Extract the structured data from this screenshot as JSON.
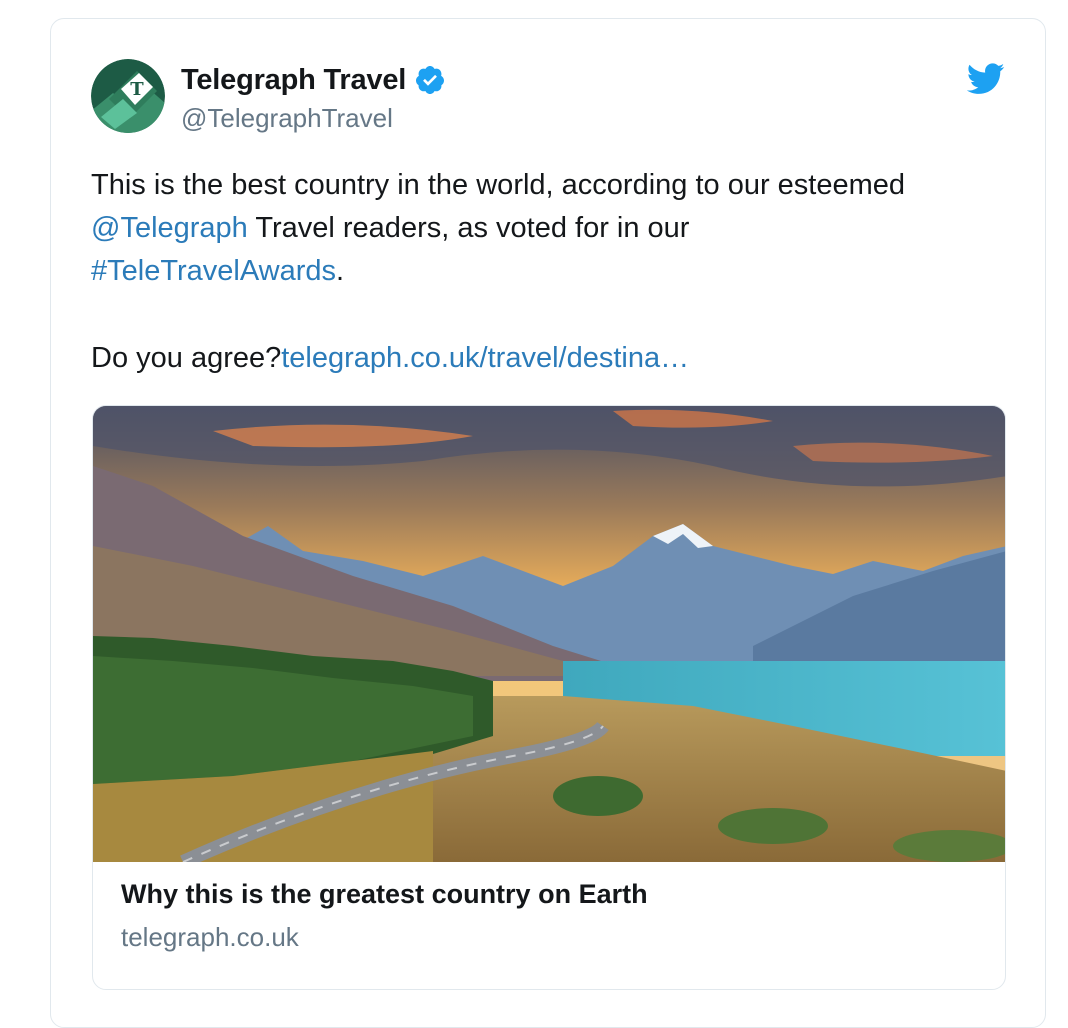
{
  "author": {
    "display_name": "Telegraph Travel",
    "handle": "@TelegraphTravel",
    "verified": true,
    "avatar_icon": "telegraph-logo-icon"
  },
  "platform_icon": "twitter-bird-icon",
  "tweet": {
    "line1": "This is the best country in the world, according to our esteemed",
    "mention": "@Telegraph",
    "line2_rest": " Travel readers, as voted for in our",
    "hashtag": "#TeleTravelAwards",
    "period": ".",
    "question": "Do you agree?",
    "link": "telegraph.co.uk/travel/destina…"
  },
  "card": {
    "title": "Why this is the greatest country on Earth",
    "domain": "telegraph.co.uk"
  },
  "colors": {
    "link": "#2b7bb9",
    "text": "#14171a",
    "secondary": "#657786",
    "twitter_blue": "#1da1f2",
    "border": "#e1e8ed"
  }
}
